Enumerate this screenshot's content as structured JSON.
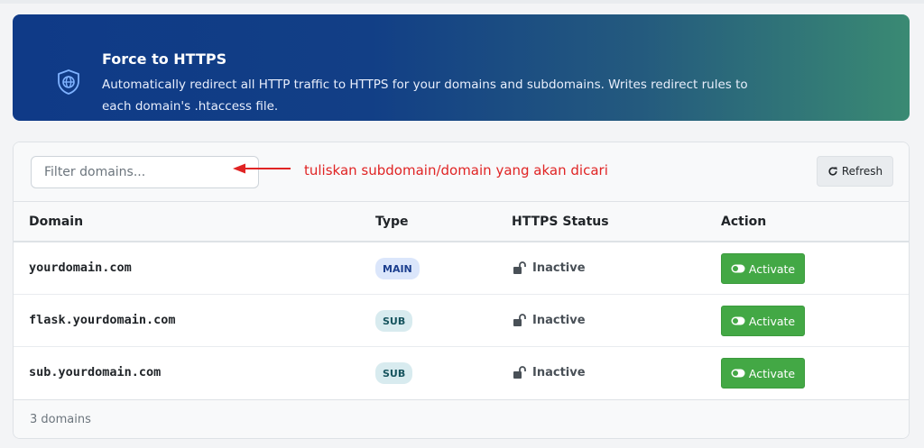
{
  "banner": {
    "icon": "shield-globe-icon",
    "title": "Force to HTTPS",
    "description": "Automatically redirect all HTTP traffic to HTTPS for your domains and subdomains. Writes redirect rules to each domain's .htaccess file."
  },
  "toolbar": {
    "filter_placeholder": "Filter domains...",
    "filter_value": "",
    "refresh_label": "Refresh",
    "refresh_icon": "refresh-icon"
  },
  "annotation": {
    "text": "tuliskan subdomain/domain yang akan dicari",
    "color": "#e02424"
  },
  "table": {
    "headers": {
      "domain": "Domain",
      "type": "Type",
      "status": "HTTPS Status",
      "action": "Action"
    },
    "rows": [
      {
        "domain": "yourdomain.com",
        "type": "MAIN",
        "status": "Inactive",
        "action": "Activate"
      },
      {
        "domain": "flask.yourdomain.com",
        "type": "SUB",
        "status": "Inactive",
        "action": "Activate"
      },
      {
        "domain": "sub.yourdomain.com",
        "type": "SUB",
        "status": "Inactive",
        "action": "Activate"
      }
    ]
  },
  "footer": {
    "count_text": "3 domains"
  },
  "colors": {
    "banner_start": "#0f3a87",
    "banner_end": "#3a8a73",
    "activate_green": "#43a845",
    "badge_main_bg": "#dbe6fb",
    "badge_sub_bg": "#d8ebef"
  }
}
